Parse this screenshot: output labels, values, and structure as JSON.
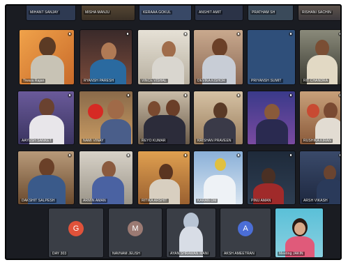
{
  "meeting": {
    "top_row": [
      {
        "name": "MIHANT SANJAY"
      },
      {
        "name": "MISHA MANJU"
      },
      {
        "name": "KERAAA GOKUL"
      },
      {
        "name": "ANSHIT AMIT"
      },
      {
        "name": "PRATHAM SH"
      },
      {
        "name": "RISHANI SACHIN"
      }
    ],
    "row2": [
      {
        "name": "Tiwara Rajan"
      },
      {
        "name": "RYANSH PARESH"
      },
      {
        "name": "VINCE VISHAL"
      },
      {
        "name": "DEVIKA KISHOR"
      },
      {
        "name": "PRIYANSH SUMIT"
      },
      {
        "name": "RIT CHANDRA"
      }
    ],
    "row3": [
      {
        "name": "AAYUSH SANKET"
      },
      {
        "name": "NAMI VINAY"
      },
      {
        "name": "REYO KUMAR"
      },
      {
        "name": "KRISHAN PRAVEEN"
      },
      {
        "name": ""
      },
      {
        "name": "RUSHIKA KIRAN"
      }
    ],
    "row4": [
      {
        "name": "DAKSHIT SALPESH"
      },
      {
        "name": "ARMIN AMAN"
      },
      {
        "name": "RITIKA ARSHIT"
      },
      {
        "name": "KARAN OM"
      },
      {
        "name": "PINU AMAN"
      },
      {
        "name": "ARSH VIKASH"
      }
    ],
    "bottom_row": [
      {
        "name": "DAY 303",
        "letter": "G",
        "color": "#e0523a"
      },
      {
        "name": "NAVNAM JEUSH",
        "letter": "M",
        "color": "#9b7a73"
      },
      {
        "name": "AYAN SHRAWAN MANI",
        "letter": "",
        "color": ""
      },
      {
        "name": "AKSH AMEETRAN",
        "letter": "A",
        "color": "#4b6ed6"
      },
      {
        "name": "Meeting JAKIN",
        "letter": "",
        "color": ""
      }
    ]
  }
}
